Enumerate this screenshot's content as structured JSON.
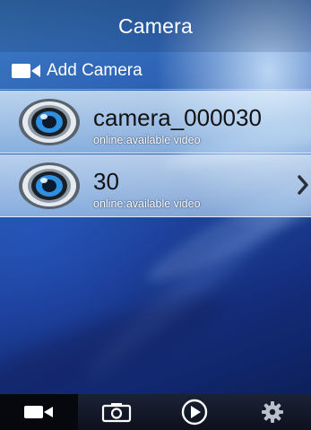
{
  "header": {
    "title": "Camera"
  },
  "add_camera": {
    "label": "Add Camera",
    "icon": "video-camera-icon"
  },
  "cameras": [
    {
      "name": "camera_000030",
      "status": "online:available video",
      "icon": "camera-lens-icon"
    },
    {
      "name": "30",
      "status": "online:available video",
      "icon": "camera-lens-icon"
    }
  ],
  "tabs": [
    {
      "name": "video-camera-icon",
      "active": true
    },
    {
      "name": "photo-camera-icon",
      "active": false
    },
    {
      "name": "play-icon",
      "active": false
    },
    {
      "name": "gear-icon",
      "active": false
    }
  ],
  "colors": {
    "accent": "#2c5fb3",
    "list_item_bg": "#d6e8f7",
    "tab_bar_bg": "#151b2b",
    "lens_iris": "#2f8fe0"
  }
}
